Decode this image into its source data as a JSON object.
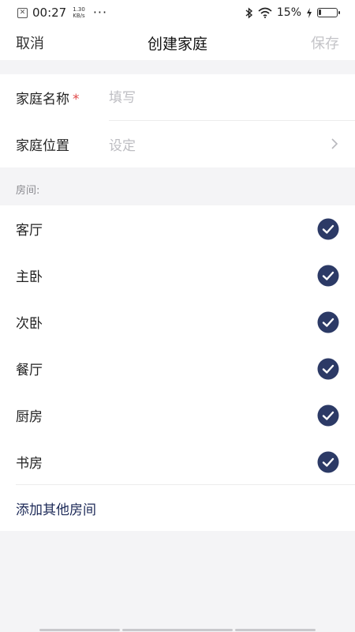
{
  "status_bar": {
    "time": "00:27",
    "speed_value": "1.30",
    "speed_unit": "KB/s",
    "more": "···",
    "battery_percent": "15%",
    "battery_level": 0.15
  },
  "nav": {
    "cancel_label": "取消",
    "title": "创建家庭",
    "save_label": "保存"
  },
  "form": {
    "name_label": "家庭名称",
    "required_mark": "*",
    "name_value": "",
    "name_placeholder": "填写",
    "location_label": "家庭位置",
    "location_value": "设定"
  },
  "rooms": {
    "header": "房间:",
    "items": [
      {
        "label": "客厅",
        "checked": true
      },
      {
        "label": "主卧",
        "checked": true
      },
      {
        "label": "次卧",
        "checked": true
      },
      {
        "label": "餐厅",
        "checked": true
      },
      {
        "label": "厨房",
        "checked": true
      },
      {
        "label": "书房",
        "checked": true
      }
    ],
    "add_label": "添加其他房间"
  },
  "colors": {
    "accent": "#2c3a66",
    "required": "#e04848",
    "background": "#f4f4f6"
  },
  "icons": {
    "chevron": "chevron-right-icon",
    "check": "check-circle-icon"
  }
}
